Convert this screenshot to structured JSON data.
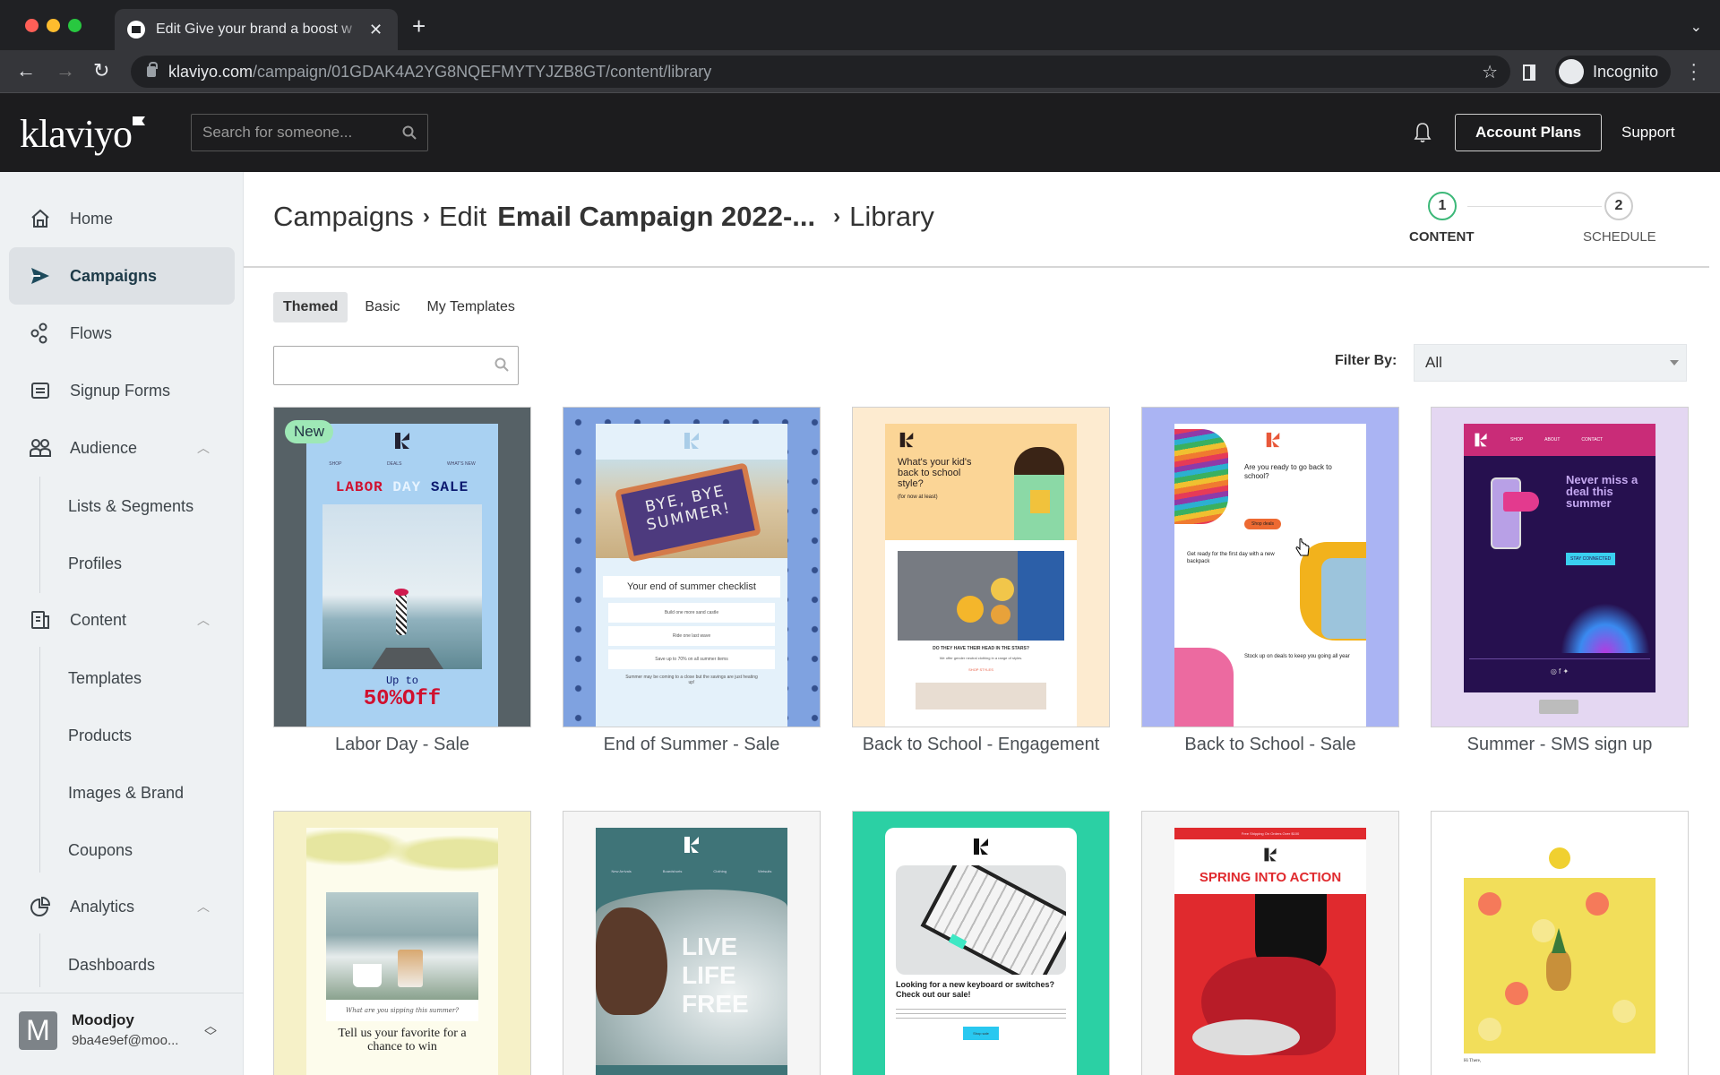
{
  "browser": {
    "tab_title": "Edit Give your brand a boost w",
    "url_domain": "klaviyo.com",
    "url_path": "/campaign/01GDAK4A2YG8NQEFMYTYJZB8GT/content/library",
    "profile_label": "Incognito"
  },
  "header": {
    "logo": "klaviyo",
    "search_placeholder": "Search for someone...",
    "account_plans": "Account Plans",
    "support": "Support"
  },
  "sidebar": {
    "items": [
      {
        "label": "Home",
        "icon": "home-icon"
      },
      {
        "label": "Campaigns",
        "icon": "send-icon",
        "active": true
      },
      {
        "label": "Flows",
        "icon": "flows-icon"
      },
      {
        "label": "Signup Forms",
        "icon": "form-icon"
      },
      {
        "label": "Audience",
        "icon": "people-icon",
        "expanded": true
      },
      {
        "label": "Content",
        "icon": "content-icon",
        "expanded": true
      },
      {
        "label": "Analytics",
        "icon": "pie-chart-icon",
        "expanded": true
      }
    ],
    "audience_sub": [
      "Lists & Segments",
      "Profiles"
    ],
    "content_sub": [
      "Templates",
      "Products",
      "Images & Brand",
      "Coupons"
    ],
    "analytics_sub": [
      "Dashboards"
    ],
    "account": {
      "initial": "M",
      "name": "Moodjoy",
      "email": "9ba4e9ef@moo..."
    }
  },
  "breadcrumb": {
    "campaigns": "Campaigns",
    "edit": "Edit",
    "campaign_name": "Email Campaign 2022-...",
    "library": "Library"
  },
  "steps": [
    {
      "number": "1",
      "label": "CONTENT",
      "active": true
    },
    {
      "number": "2",
      "label": "SCHEDULE",
      "active": false
    }
  ],
  "library": {
    "tabs": [
      "Themed",
      "Basic",
      "My Templates"
    ],
    "active_tab": "Themed",
    "search_value": "",
    "filter_label": "Filter By:",
    "filter_value": "All",
    "templates": [
      {
        "name": "Labor Day - Sale",
        "badge": "New",
        "preview": {
          "nav": [
            "SHOP",
            "DEALS",
            "WHAT'S NEW"
          ],
          "headline": [
            "LABOR",
            "DAY",
            "SALE"
          ],
          "sub": "Up to",
          "offer": "50%Off"
        }
      },
      {
        "name": "End of Summer - Sale",
        "preview": {
          "sign": "BYE, BYE SUMMER!",
          "checklist_title": "Your end of summer checklist",
          "items": [
            "Build one more sand castle",
            "Ride one last wave",
            "Save up to 70% on all summer items"
          ],
          "footer": "Summer may be coming to a close but the savings are just heating up!"
        }
      },
      {
        "name": "Back to School - Engagement",
        "preview": {
          "headline": "What's your kid's back to school style?",
          "sub": "(for now at least)",
          "section": "DO THEY HAVE THEIR HEAD IN THE STARS?",
          "body": "We offer gender neutral clothing in a range of styles.",
          "cta": "SHOP STYLES"
        }
      },
      {
        "name": "Back to School - Sale",
        "preview": {
          "h1": "Are you ready to go back to school?",
          "cta": "Shop deals",
          "h2": "Get ready for the first day with a new backpack",
          "h3": "Stock up on deals to keep you going all year"
        }
      },
      {
        "name": "Summer - SMS sign up",
        "preview": {
          "nav": [
            "SHOP",
            "ABOUT",
            "CONTACT"
          ],
          "headline": "Never miss a deal this summer",
          "cta": "STAY CONNECTED"
        }
      },
      {
        "name": "",
        "preview": {
          "script": "What are you sipping this summer?",
          "headline": "Tell us your favorite for a chance to win"
        }
      },
      {
        "name": "",
        "preview": {
          "nav": [
            "New Arrivals",
            "Boardshorts",
            "Clothing",
            "Wetsuits"
          ],
          "headline": [
            "LIVE",
            "LIFE",
            "FREE"
          ]
        }
      },
      {
        "name": "",
        "preview": {
          "headline": "Looking for a new keyboard or switches? Check out our sale!",
          "cta": "Shop sale"
        }
      },
      {
        "name": "",
        "preview": {
          "banner": "Free Shipping On Orders Over $100",
          "headline": "SPRING INTO ACTION"
        }
      },
      {
        "name": "",
        "preview": {
          "greeting": "Hi There,"
        }
      }
    ]
  },
  "colors": {
    "header_bg": "#1c1c1e",
    "sidebar_bg": "#eef1f3",
    "active_step": "#3cb878",
    "new_badge": "#9ee8b6"
  }
}
